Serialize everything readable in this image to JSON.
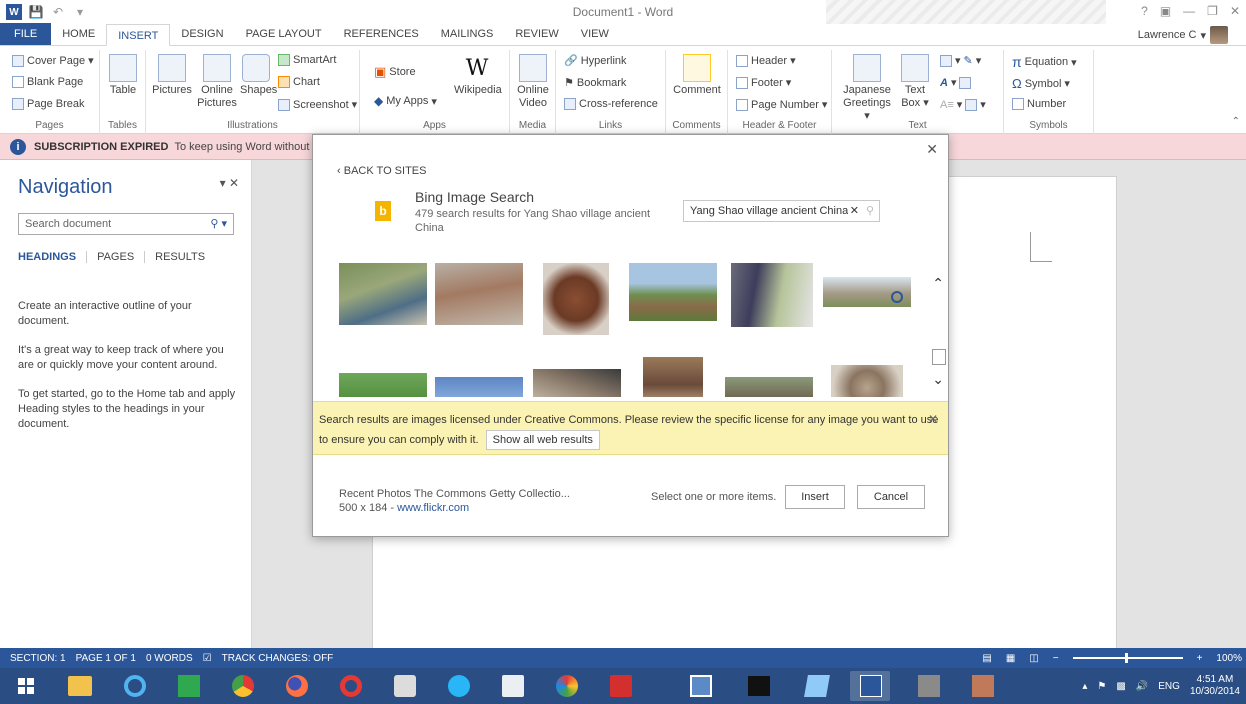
{
  "window": {
    "title": "Document1 - Word",
    "user": "Lawrence C"
  },
  "tabs": [
    "FILE",
    "HOME",
    "INSERT",
    "DESIGN",
    "PAGE LAYOUT",
    "REFERENCES",
    "MAILINGS",
    "REVIEW",
    "VIEW"
  ],
  "active_tab": "INSERT",
  "ribbon": {
    "pages": {
      "cover": "Cover Page",
      "blank": "Blank Page",
      "break": "Page Break",
      "label": "Pages"
    },
    "tables": {
      "table": "Table",
      "label": "Tables"
    },
    "illustrations": {
      "pictures": "Pictures",
      "online1": "Online",
      "online2": "Pictures",
      "shapes": "Shapes",
      "smartart": "SmartArt",
      "chart": "Chart",
      "screenshot": "Screenshot",
      "label": "Illustrations"
    },
    "apps": {
      "store": "Store",
      "myapps": "My Apps",
      "wikipedia": "Wikipedia",
      "label": "Apps"
    },
    "media": {
      "online1": "Online",
      "video": "Video",
      "label": "Media"
    },
    "links": {
      "hyperlink": "Hyperlink",
      "bookmark": "Bookmark",
      "crossref": "Cross-reference",
      "label": "Links"
    },
    "comments": {
      "comment": "Comment",
      "label": "Comments"
    },
    "headerfooter": {
      "header": "Header",
      "footer": "Footer",
      "pagenumber": "Page Number",
      "label": "Header & Footer"
    },
    "text": {
      "japanese1": "Japanese",
      "japanese2": "Greetings",
      "textbox1": "Text",
      "textbox2": "Box",
      "label": "Text"
    },
    "symbols": {
      "equation": "Equation",
      "symbol": "Symbol",
      "number": "Number",
      "label": "Symbols"
    }
  },
  "notification": {
    "title": "SUBSCRIPTION EXPIRED",
    "message": "To keep using Word without"
  },
  "navigation": {
    "title": "Navigation",
    "search_placeholder": "Search document",
    "tabs": [
      "HEADINGS",
      "PAGES",
      "RESULTS"
    ],
    "p1": "Create an interactive outline of your document.",
    "p2": "It's a great way to keep track of where you are or quickly move your content around.",
    "p3": "To get started, go to the Home tab and apply Heading styles to the headings in your document."
  },
  "dialog": {
    "back": "BACK TO SITES",
    "site_title": "Bing Image Search",
    "site_sub": "479 search results for Yang Shao village ancient China",
    "search_value": "Yang Shao village ancient China",
    "license_text": "Search results are images licensed under Creative Commons. Please review the specific license for any image you want to use to ensure you can comply with it.",
    "show_all": "Show all web results",
    "source": "Recent Photos The Commons Getty Collectio...",
    "source_detail": "500 x 184 - ",
    "source_link": "www.flickr.com",
    "hint": "Select one or more items.",
    "insert": "Insert",
    "cancel": "Cancel"
  },
  "status": {
    "section": "SECTION: 1",
    "page": "PAGE 1 OF 1",
    "words": "0 WORDS",
    "track": "TRACK CHANGES: OFF",
    "zoom": "100%"
  },
  "tray": {
    "lang": "ENG",
    "time": "4:51 AM",
    "date": "10/30/2014"
  }
}
